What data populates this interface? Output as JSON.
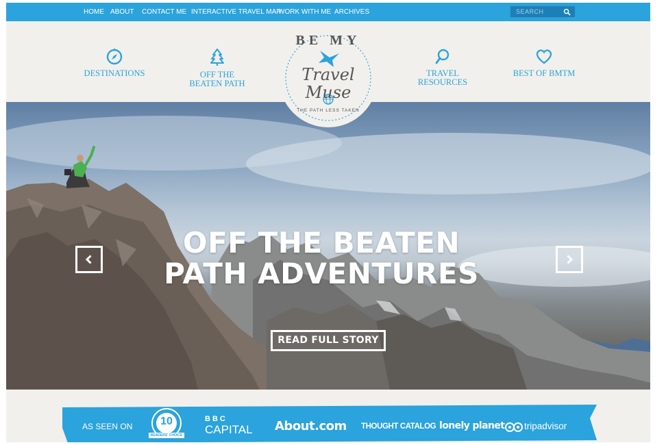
{
  "nav": {
    "items": [
      "HOME",
      "ABOUT",
      "CONTACT ME",
      "INTERACTIVE TRAVEL MAP",
      "WORK WITH ME",
      "ARCHIVES"
    ],
    "search_placeholder": "SEARCH"
  },
  "categories": [
    {
      "line1": "DESTINATIONS",
      "line2": "",
      "icon": "compass-icon"
    },
    {
      "line1": "OFF THE",
      "line2": "BEATEN PATH",
      "icon": "tree-icon"
    },
    {
      "line1": "TRAVEL",
      "line2": "RESOURCES",
      "icon": "magnifier-icon"
    },
    {
      "line1": "BEST OF BMTM",
      "line2": "",
      "icon": "heart-icon"
    }
  ],
  "logo": {
    "top": "BE MY",
    "script": "Travel Muse",
    "bottom": "THE PATH LESS TAKEN"
  },
  "hero": {
    "title_line1": "OFF THE BEATEN",
    "title_line2": "PATH ADVENTURES",
    "button": "READ FULL STORY"
  },
  "seen_on": {
    "label": "AS SEEN ON",
    "usa_today": "10",
    "usa_today_caption": "READERS' CHOICE",
    "bbc_top": "BBC",
    "bbc_bottom": "CAPITAL",
    "about": "About.com",
    "thought": "THOUGHT CATALOG",
    "lonely": "lonely planet",
    "trip": "tripadvisor"
  },
  "colors": {
    "brand_blue": "#2ba3dc",
    "dark_blue": "#1d7fb8",
    "cream": "#f1f0ec",
    "logo_text": "#555555"
  }
}
